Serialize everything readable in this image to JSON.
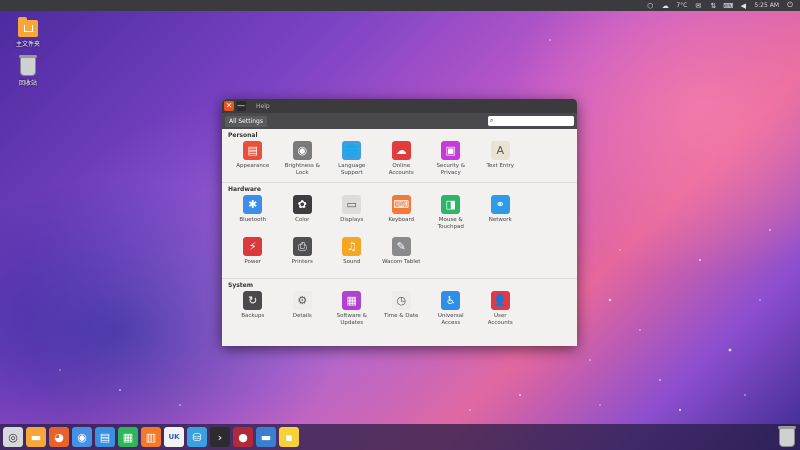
{
  "top_panel": {
    "weather": "7°C",
    "clock": "5:25 AM",
    "icons": [
      "dropbox-icon",
      "weather-icon",
      "email-icon",
      "network-icon",
      "keyboard-icon",
      "volume-icon",
      "power-icon"
    ]
  },
  "desktop": {
    "items": [
      {
        "label": "主文件夹",
        "icon": "home-folder-icon"
      },
      {
        "label": "回收站",
        "icon": "trash-icon"
      }
    ]
  },
  "window": {
    "title": "Help",
    "all_settings_label": "All Settings",
    "search_placeholder": "",
    "sections": [
      {
        "title": "Personal",
        "items": [
          {
            "label": "Appearance",
            "icon": "appearance-icon",
            "color": "#e8503c"
          },
          {
            "label": "Brightness &\nLock",
            "icon": "brightness-lock-icon",
            "color": "#7a7a7a"
          },
          {
            "label": "Language\nSupport",
            "icon": "language-support-icon",
            "color": "#3aa0e0"
          },
          {
            "label": "Online\nAccounts",
            "icon": "online-accounts-icon",
            "color": "#e23b3b"
          },
          {
            "label": "Security &\nPrivacy",
            "icon": "security-privacy-icon",
            "color": "#c53bd9"
          },
          {
            "label": "Text Entry",
            "icon": "text-entry-icon",
            "color": "#e9e3d2"
          }
        ]
      },
      {
        "title": "Hardware",
        "items": [
          {
            "label": "Bluetooth",
            "icon": "bluetooth-icon",
            "color": "#3c8fe8"
          },
          {
            "label": "Color",
            "icon": "color-icon",
            "color": "#3d3d3f"
          },
          {
            "label": "Displays",
            "icon": "displays-icon",
            "color": "#dcdcdc"
          },
          {
            "label": "Keyboard",
            "icon": "keyboard-icon",
            "color": "#f07a3a"
          },
          {
            "label": "Mouse &\nTouchpad",
            "icon": "mouse-touchpad-icon",
            "color": "#2fb56a"
          },
          {
            "label": "Network",
            "icon": "network-icon",
            "color": "#2f9be8"
          },
          {
            "label": "Power",
            "icon": "power-icon",
            "color": "#d93a3a"
          },
          {
            "label": "Printers",
            "icon": "printers-icon",
            "color": "#505052"
          },
          {
            "label": "Sound",
            "icon": "sound-icon",
            "color": "#f5a623"
          },
          {
            "label": "Wacom Tablet",
            "icon": "wacom-tablet-icon",
            "color": "#8a8a8c"
          }
        ]
      },
      {
        "title": "System",
        "items": [
          {
            "label": "Backups",
            "icon": "backups-icon",
            "color": "#4a4a4c"
          },
          {
            "label": "Details",
            "icon": "details-icon",
            "color": "#ececec"
          },
          {
            "label": "Software &\nUpdates",
            "icon": "software-updates-icon",
            "color": "#b042d0"
          },
          {
            "label": "Time & Date",
            "icon": "time-date-icon",
            "color": "#ececec"
          },
          {
            "label": "Universal\nAccess",
            "icon": "universal-access-icon",
            "color": "#2f8fe8"
          },
          {
            "label": "User\nAccounts",
            "icon": "user-accounts-icon",
            "color": "#e03a4a"
          }
        ]
      }
    ]
  },
  "dock": {
    "items": [
      {
        "name": "dash-icon",
        "color": "#d8d8dc"
      },
      {
        "name": "files-icon",
        "color": "#f6a63a"
      },
      {
        "name": "firefox-icon",
        "color": "#e8622c"
      },
      {
        "name": "chromium-icon",
        "color": "#4a90e2"
      },
      {
        "name": "libreoffice-writer-icon",
        "color": "#3a8fe0"
      },
      {
        "name": "libreoffice-calc-icon",
        "color": "#2fb55a"
      },
      {
        "name": "libreoffice-impress-icon",
        "color": "#f07a2a"
      },
      {
        "name": "uk-keyboard-icon",
        "color": "#f2f2f2",
        "text": "UK"
      },
      {
        "name": "drive-icon",
        "color": "#3aa0e0"
      },
      {
        "name": "terminal-icon",
        "color": "#2c2c30"
      },
      {
        "name": "screen-recorder-icon",
        "color": "#b02a3a"
      },
      {
        "name": "folder-blue-icon",
        "color": "#3a7fd0"
      },
      {
        "name": "save-disk-icon",
        "color": "#f5d23a"
      }
    ]
  }
}
